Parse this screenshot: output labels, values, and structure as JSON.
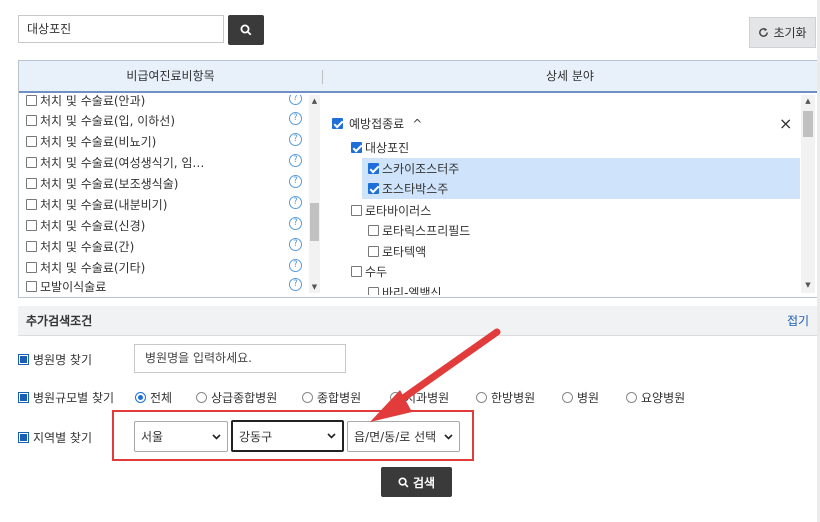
{
  "search": {
    "value": "대상포진"
  },
  "reset_label": "초기화",
  "panel": {
    "left_header": "비급여진료비항목",
    "right_header": "상세 분야",
    "left_items": [
      "처치 및 수술료(안과)",
      "처치 및 수술료(입, 이하선)",
      "처치 및 수술료(비뇨기)",
      "처치 및 수술료(여성생식기, 임…",
      "처치 및 수술료(보조생식술)",
      "처치 및 수술료(내분비기)",
      "처치 및 수술료(신경)",
      "처치 및 수술료(간)",
      "처치 및 수술료(기타)",
      "모발이식술료"
    ],
    "tree": {
      "root": "예방접종료",
      "collapse_glyph": "^",
      "close_glyph": "×",
      "n1": "대상포진",
      "n1a": "스카이조스터주",
      "n1b": "조스타박스주",
      "n2": "로타바이러스",
      "n2a": "로타릭스프리필드",
      "n2b": "로타텍액",
      "n3": "수두",
      "n3a": "바리-엘백신"
    }
  },
  "additional": {
    "title": "추가검색조건",
    "fold_label": "접기",
    "hospital_name_label": "병원명 찾기",
    "hospital_name_placeholder": "병원명을 입력하세요.",
    "hospital_size_label": "병원규모별 찾기",
    "sizes": [
      "전체",
      "상급종합병원",
      "종합병원",
      "치과병원",
      "한방병원",
      "병원",
      "요양병원"
    ],
    "region_label": "지역별 찾기",
    "city": "서울",
    "district": "강동구",
    "town": "읍/면/동/로 선택"
  },
  "search_button": "검색",
  "colors": {
    "accent": "#1e6fd9",
    "highlight": "#cfe3fa",
    "arrow": "#e23b3b",
    "dark_button": "#3a3a3a"
  }
}
